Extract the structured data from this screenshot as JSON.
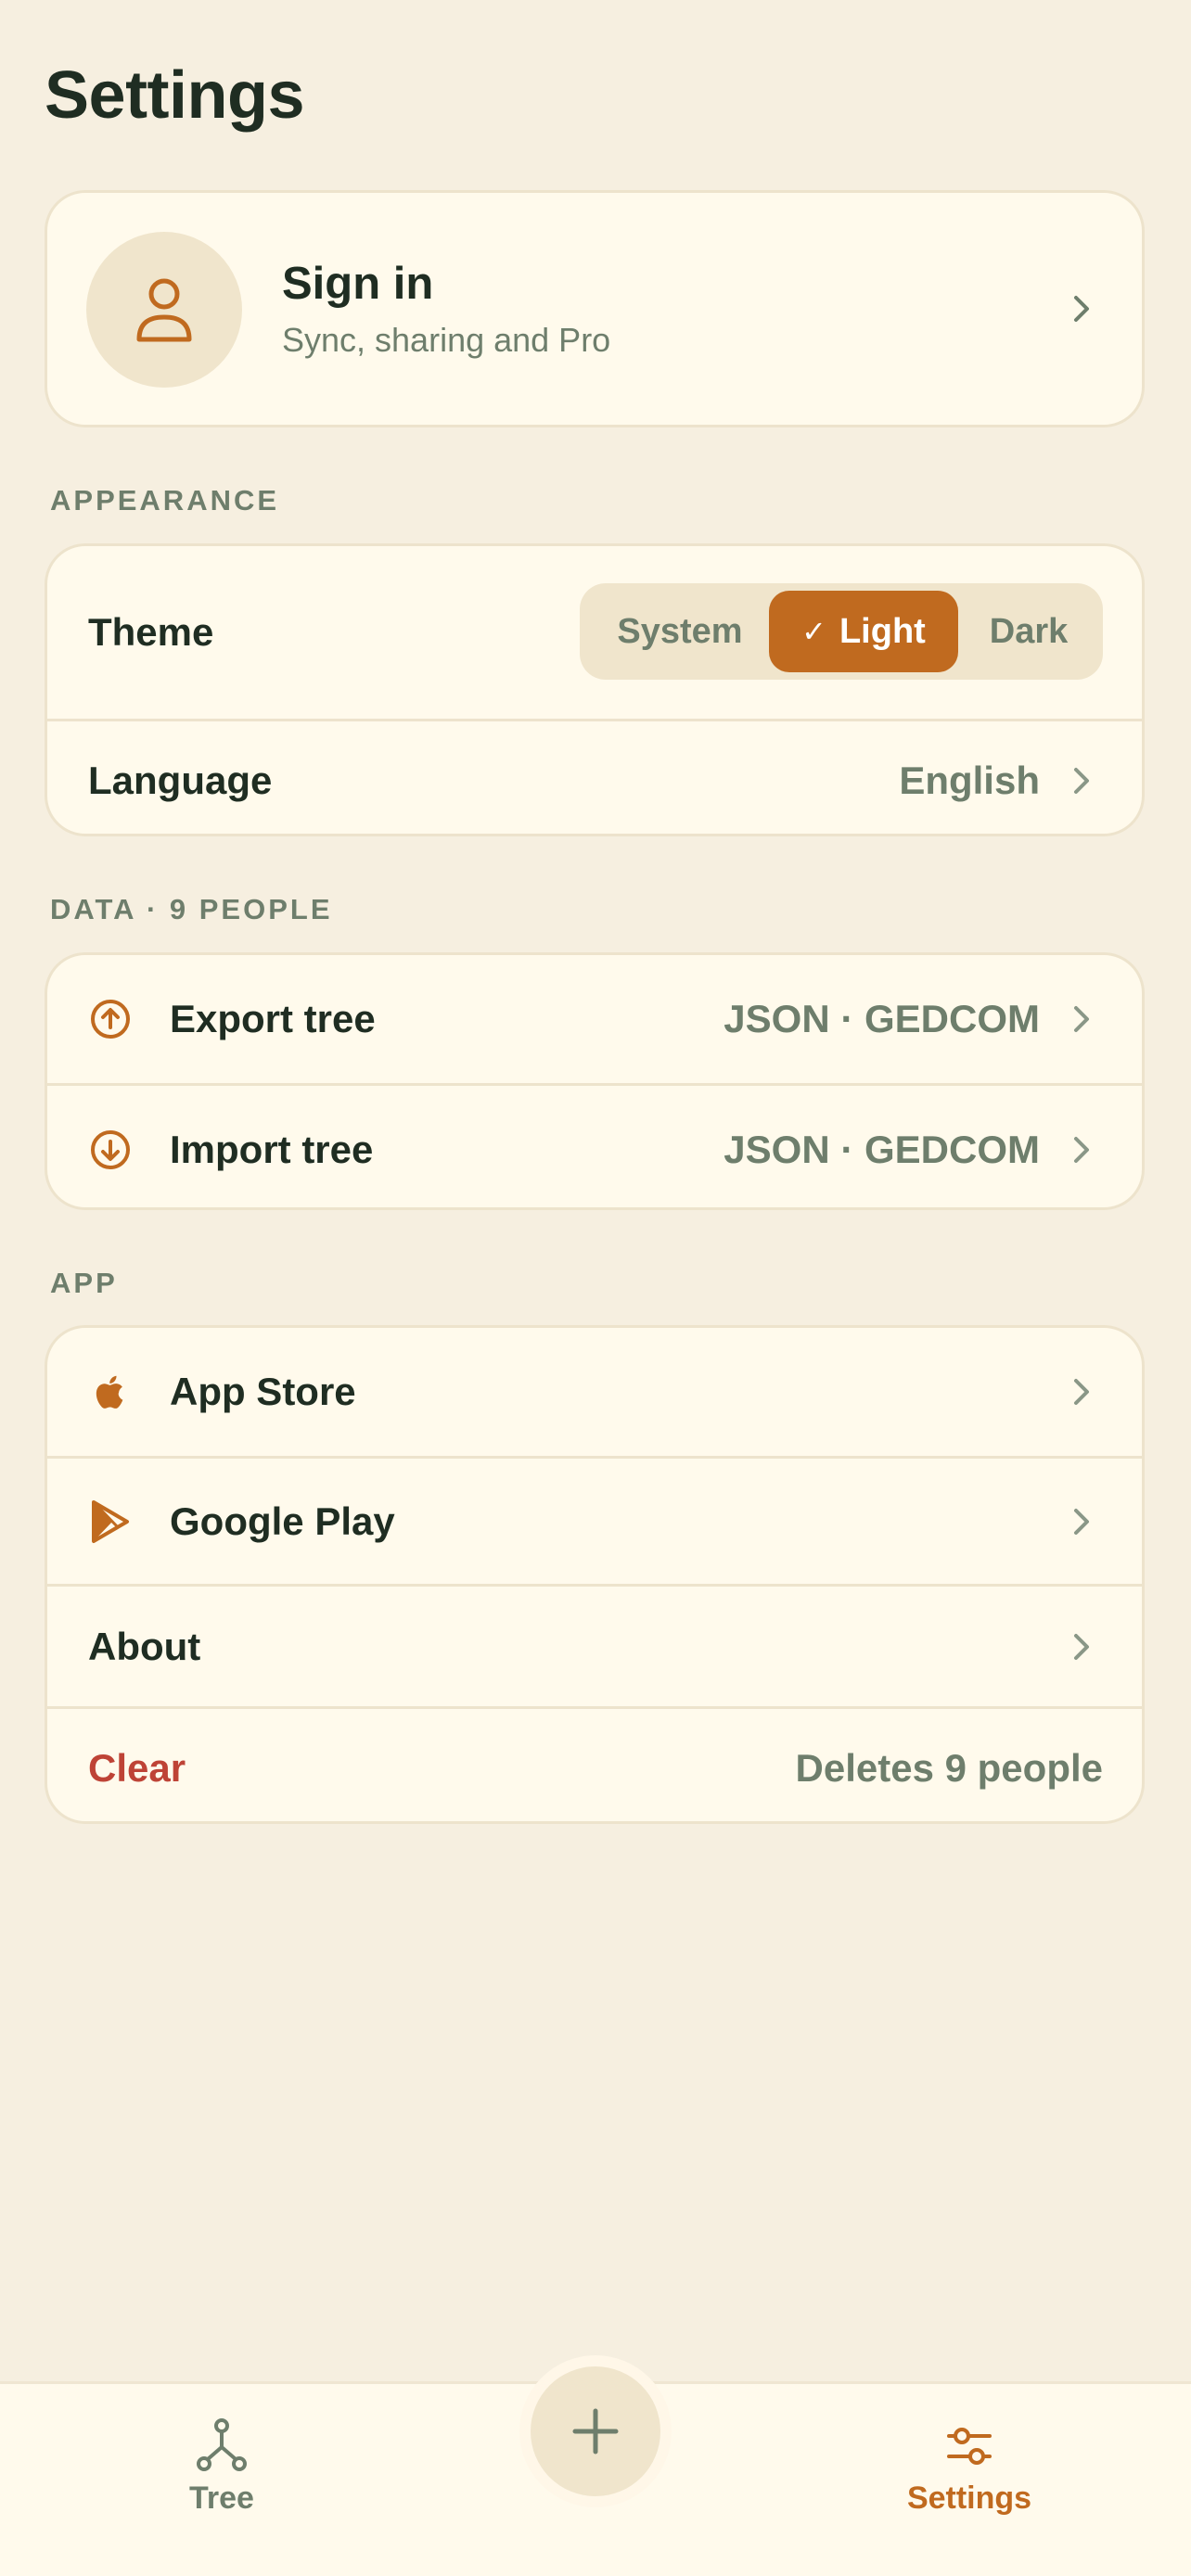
{
  "header": {
    "title": "Settings"
  },
  "account": {
    "title": "Sign in",
    "subtitle": "Sync, sharing and Pro",
    "avatar_icon": "person-icon"
  },
  "appearance": {
    "label": "APPEARANCE",
    "theme": {
      "label": "Theme",
      "options": [
        "System",
        "Light",
        "Dark"
      ],
      "selected": "Light"
    },
    "language": {
      "label": "Language",
      "value": "English"
    }
  },
  "data": {
    "label": "DATA · 9 PEOPLE",
    "export": {
      "label": "Export tree",
      "value": "JSON · GEDCOM",
      "icon": "arrow-up-circle-icon"
    },
    "import": {
      "label": "Import tree",
      "value": "JSON · GEDCOM",
      "icon": "arrow-down-circle-icon"
    }
  },
  "app": {
    "label": "APP",
    "app_store": {
      "label": "App Store",
      "icon": "apple-icon"
    },
    "google_play": {
      "label": "Google Play",
      "icon": "google-play-icon"
    },
    "about": {
      "label": "About"
    },
    "clear": {
      "label": "Clear",
      "value": "Deletes 9 people"
    }
  },
  "tabbar": {
    "tree": {
      "label": "Tree",
      "icon": "tree-icon"
    },
    "add": {
      "icon": "plus-icon"
    },
    "settings": {
      "label": "Settings",
      "icon": "sliders-icon"
    }
  },
  "colors": {
    "background": "#F6EFE0",
    "card": "#FFFAEC",
    "accent": "#C06A1F",
    "muted": "#6E7E6C",
    "text": "#1F2D22",
    "danger": "#BE4336"
  }
}
